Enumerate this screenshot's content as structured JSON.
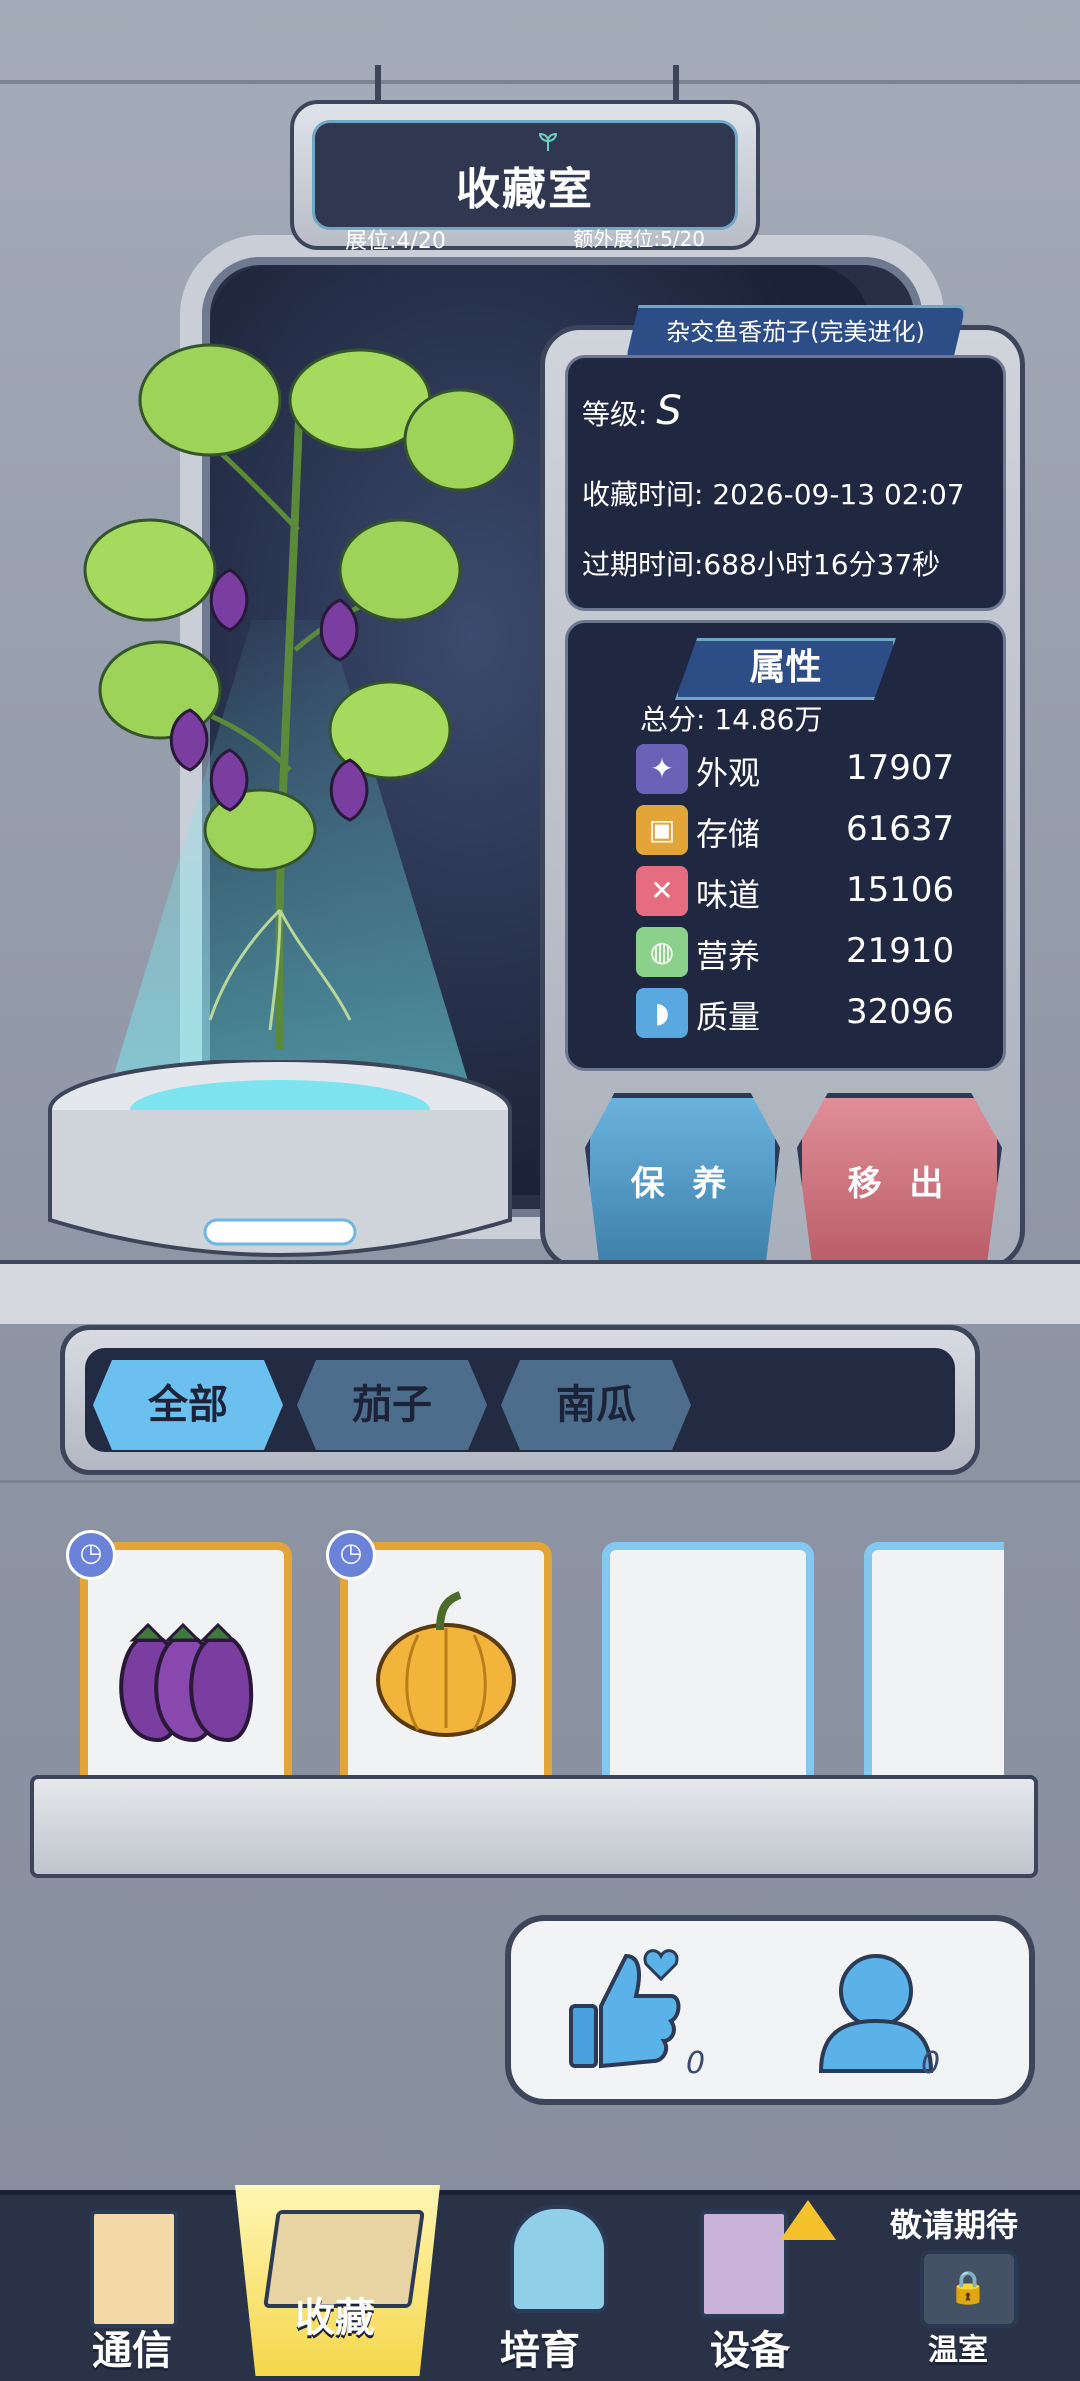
{
  "title": {
    "text": "收藏室",
    "slots": "展位:4/20",
    "extra_slots": "额外展位:5/20"
  },
  "item": {
    "name": "杂交鱼香茄子(完美进化)",
    "grade_label": "等级:",
    "grade_value": "S",
    "collect_time": "收藏时间: 2026-09-13 02:07",
    "expire_time": "过期时间:688小时16分37秒"
  },
  "attributes": {
    "header": "属性",
    "total": "总分: 14.86万",
    "rows": [
      {
        "name": "外观",
        "value": "17907",
        "color": "#6b62b8",
        "icon": "sparkle-icon"
      },
      {
        "name": "存储",
        "value": "61637",
        "color": "#e3a538",
        "icon": "box-icon"
      },
      {
        "name": "味道",
        "value": "15106",
        "color": "#e66c80",
        "icon": "utensils-icon"
      },
      {
        "name": "营养",
        "value": "21910",
        "color": "#8bd18b",
        "icon": "lemon-icon"
      },
      {
        "name": "质量",
        "value": "32096",
        "color": "#5aa8e0",
        "icon": "muscle-icon"
      }
    ]
  },
  "actions": {
    "care": "保 养",
    "remove": "移 出"
  },
  "categories": [
    {
      "label": "全部",
      "active": true
    },
    {
      "label": "茄子",
      "active": false
    },
    {
      "label": "南瓜",
      "active": false
    }
  ],
  "cards": [
    {
      "type": "eggplant",
      "frame": "gold",
      "timed": true
    },
    {
      "type": "pumpkin",
      "frame": "gold",
      "timed": true
    },
    {
      "type": "empty",
      "frame": "blue",
      "timed": false
    },
    {
      "type": "empty",
      "frame": "blue",
      "timed": false
    }
  ],
  "social": {
    "likes": "0",
    "visitors": "0"
  },
  "nav": {
    "items": [
      {
        "label": "通信",
        "icon": "clipboard-icon"
      },
      {
        "label": "收藏",
        "icon": "collection-box-icon",
        "active": true
      },
      {
        "label": "培育",
        "icon": "sprout-dome-icon"
      },
      {
        "label": "设备",
        "icon": "upgrade-machine-icon"
      },
      {
        "label": "温室",
        "icon": "locked-greenhouse-icon"
      }
    ],
    "coming_soon": "敬请期待"
  }
}
